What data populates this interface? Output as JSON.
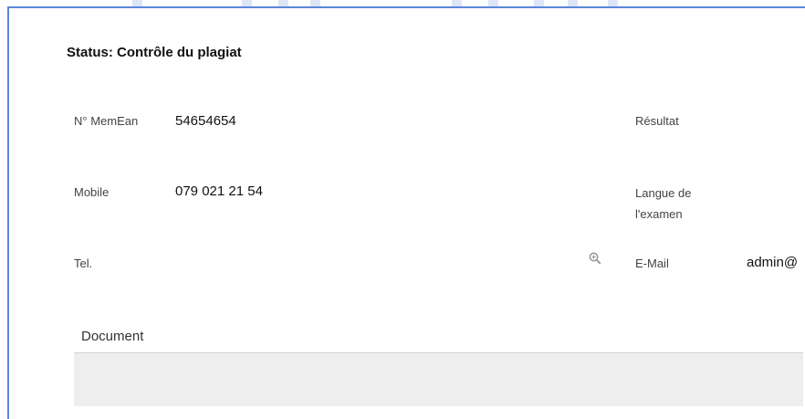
{
  "status": {
    "title": "Status: Contrôle du plagiat"
  },
  "fields": {
    "memean_label": "N° MemEan",
    "memean_value": "54654654",
    "mobile_label": "Mobile",
    "mobile_value": "079 021 21 54",
    "tel_label": "Tel.",
    "resultat_label": "Résultat",
    "langue_label_line1": "Langue de",
    "langue_label_line2": "l'examen",
    "email_label": "E-Mail",
    "email_value": "admin@"
  },
  "document": {
    "label": "Document"
  },
  "icons": {
    "tel_lookup": "search-zoom-icon"
  },
  "colors": {
    "window_border": "#5b87d8",
    "document_area": "#eeeeee",
    "header_line": "#d2d2d2"
  }
}
